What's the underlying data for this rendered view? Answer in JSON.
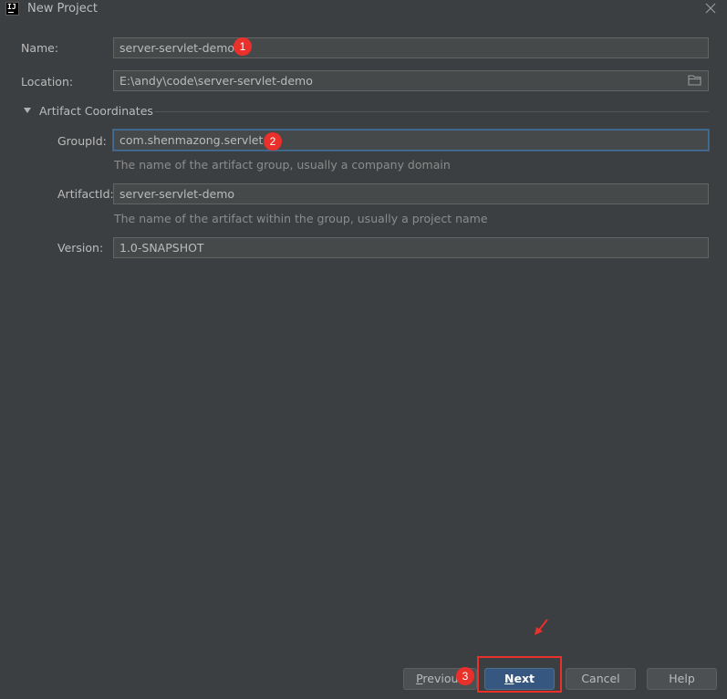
{
  "window": {
    "title": "New Project",
    "app_icon_text": "IJ"
  },
  "form": {
    "name": {
      "label": "Name:",
      "value": "server-servlet-demo"
    },
    "location": {
      "label": "Location:",
      "value": "E:\\andy\\code\\server-servlet-demo"
    },
    "artifact_section": {
      "title": "Artifact Coordinates",
      "expanded": true
    },
    "group_id": {
      "label": "GroupId:",
      "value": "com.shenmazong.servlet",
      "hint": "The name of the artifact group, usually a company domain"
    },
    "artifact_id": {
      "label": "ArtifactId:",
      "value": "server-servlet-demo",
      "hint": "The name of the artifact within the group, usually a project name"
    },
    "version": {
      "label": "Version:",
      "value": "1.0-SNAPSHOT"
    }
  },
  "annotations": {
    "badge1": "1",
    "badge2": "2",
    "badge3": "3",
    "color": "#e9302b"
  },
  "buttons": {
    "previous": {
      "mnemonic": "P",
      "rest": "revious"
    },
    "next": {
      "mnemonic": "N",
      "rest": "ext"
    },
    "cancel": "Cancel",
    "help": "Help"
  },
  "colors": {
    "background": "#3c3f41",
    "field_bg": "#45494a",
    "focus_border": "#466d94",
    "default_button": "#365880"
  },
  "icons": {
    "app": "intellij-icon",
    "close": "close-icon",
    "folder": "folder-icon",
    "section_toggle": "triangle-down-icon"
  }
}
